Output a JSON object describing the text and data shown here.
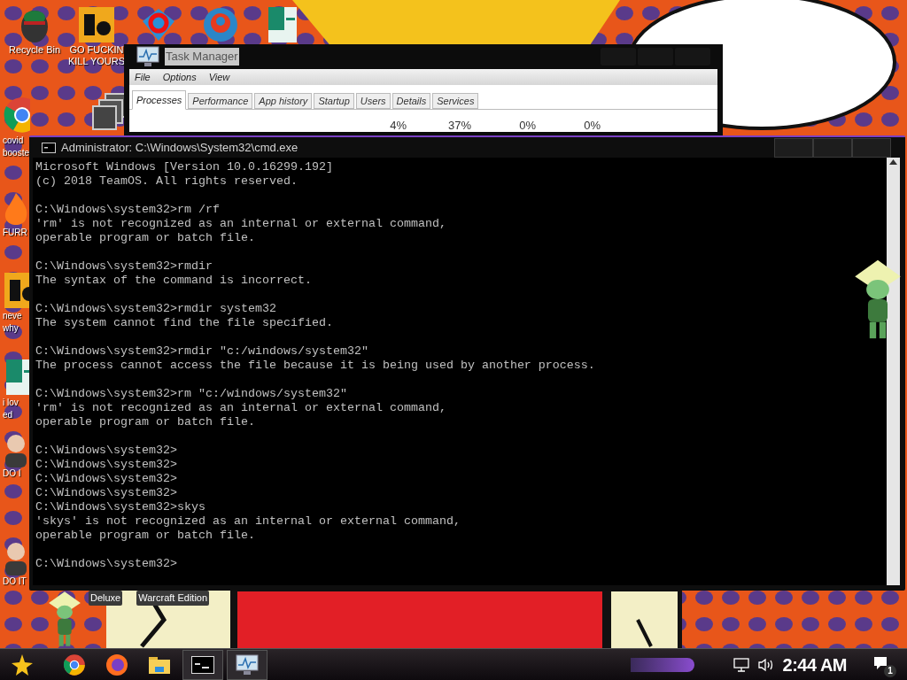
{
  "desktop_icons": [
    {
      "kind": "bin",
      "lines": [
        "Recycle Bin"
      ]
    },
    {
      "kind": "letters",
      "lines": [
        "GO FUCKIN",
        "KILL YOURS"
      ]
    },
    {
      "kind": "number"
    },
    {
      "kind": "ring"
    },
    {
      "kind": "document"
    },
    {
      "kind": "browser",
      "lines": [
        "covid",
        "booste"
      ]
    },
    {
      "kind": "stack"
    },
    {
      "kind": "flame",
      "lines": [
        "FURR"
      ]
    },
    {
      "kind": "letters",
      "lines": [
        "neve",
        "why"
      ]
    },
    {
      "kind": "document",
      "lines": [
        "i lov",
        "ed"
      ]
    },
    {
      "kind": "person",
      "lines": [
        "DO I"
      ]
    },
    {
      "kind": "person",
      "lines": [
        "DO IT"
      ]
    }
  ],
  "desktop_labels": [
    "Deluxe",
    "Warcraft Edition"
  ],
  "task_manager": {
    "title": "Task Manager",
    "menu": [
      "File",
      "Options",
      "View"
    ],
    "tabs": [
      {
        "label": "Processes",
        "selected": true
      },
      {
        "label": "Performance",
        "selected": false
      },
      {
        "label": "App history",
        "selected": false
      },
      {
        "label": "Startup",
        "selected": false
      },
      {
        "label": "Users",
        "selected": false
      },
      {
        "label": "Details",
        "selected": false
      },
      {
        "label": "Services",
        "selected": false
      }
    ],
    "column_values": [
      "4%",
      "37%",
      "0%",
      "0%"
    ]
  },
  "console": {
    "title": "Administrator: C:\\Windows\\System32\\cmd.exe",
    "blocks": [
      [
        "Microsoft Windows [Version 10.0.16299.192]",
        "(c) 2018 TeamOS. All rights reserved."
      ],
      [
        "C:\\Windows\\system32>rm /rf",
        "'rm' is not recognized as an internal or external command,",
        "operable program or batch file."
      ],
      [
        "C:\\Windows\\system32>rmdir",
        "The syntax of the command is incorrect."
      ],
      [
        "C:\\Windows\\system32>rmdir system32",
        "The system cannot find the file specified."
      ],
      [
        "C:\\Windows\\system32>rmdir \"c:/windows/system32\"",
        "The process cannot access the file because it is being used by another process."
      ],
      [
        "C:\\Windows\\system32>rm \"c:/windows/system32\"",
        "'rm' is not recognized as an internal or external command,",
        "operable program or batch file."
      ],
      [
        "C:\\Windows\\system32>",
        "C:\\Windows\\system32>",
        "C:\\Windows\\system32>",
        "C:\\Windows\\system32>",
        "C:\\Windows\\system32>skys",
        "'skys' is not recognized as an internal or external command,",
        "operable program or batch file."
      ],
      [
        "C:\\Windows\\system32>"
      ]
    ]
  },
  "taskbar": {
    "apps": [
      {
        "kind": "browser",
        "selected": false
      },
      {
        "kind": "fox",
        "selected": false
      },
      {
        "kind": "folder",
        "selected": false
      },
      {
        "kind": "console",
        "selected": true
      },
      {
        "kind": "monitor",
        "selected": true
      }
    ],
    "clock": "2:44 AM",
    "notifications": "1"
  }
}
